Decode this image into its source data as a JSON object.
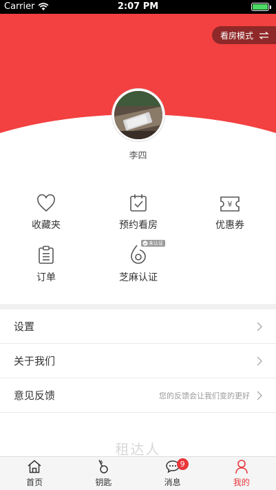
{
  "status_bar": {
    "carrier": "Carrier",
    "time": "2:07 PM",
    "battery_level": 1.0
  },
  "header": {
    "mode_button_label": "看房模式",
    "mode_icon": "swap-arrows-icon"
  },
  "profile": {
    "username": "李四"
  },
  "grid": [
    {
      "label": "收藏夹",
      "icon": "heart-icon"
    },
    {
      "label": "预约看房",
      "icon": "calendar-check-icon"
    },
    {
      "label": "优惠券",
      "icon": "yen-ticket-icon"
    },
    {
      "label": "订单",
      "icon": "clipboard-icon"
    },
    {
      "label": "芝麻认证",
      "icon": "sesame-icon",
      "badge": "未认证"
    }
  ],
  "menu": [
    {
      "label": "设置",
      "hint": ""
    },
    {
      "label": "关于我们",
      "hint": ""
    },
    {
      "label": "意见反馈",
      "hint": "您的反馈会让我们变的更好"
    }
  ],
  "brand": "租达人",
  "tabs": [
    {
      "label": "首页",
      "icon": "home-icon",
      "active": false
    },
    {
      "label": "钥匙",
      "icon": "key-icon",
      "active": false
    },
    {
      "label": "消息",
      "icon": "chat-icon",
      "badge": "9",
      "active": false
    },
    {
      "label": "我的",
      "icon": "person-icon",
      "active": true
    }
  ],
  "colors": {
    "primary": "#f34040",
    "active_tab": "#e8353b",
    "battery": "#4cd964"
  }
}
